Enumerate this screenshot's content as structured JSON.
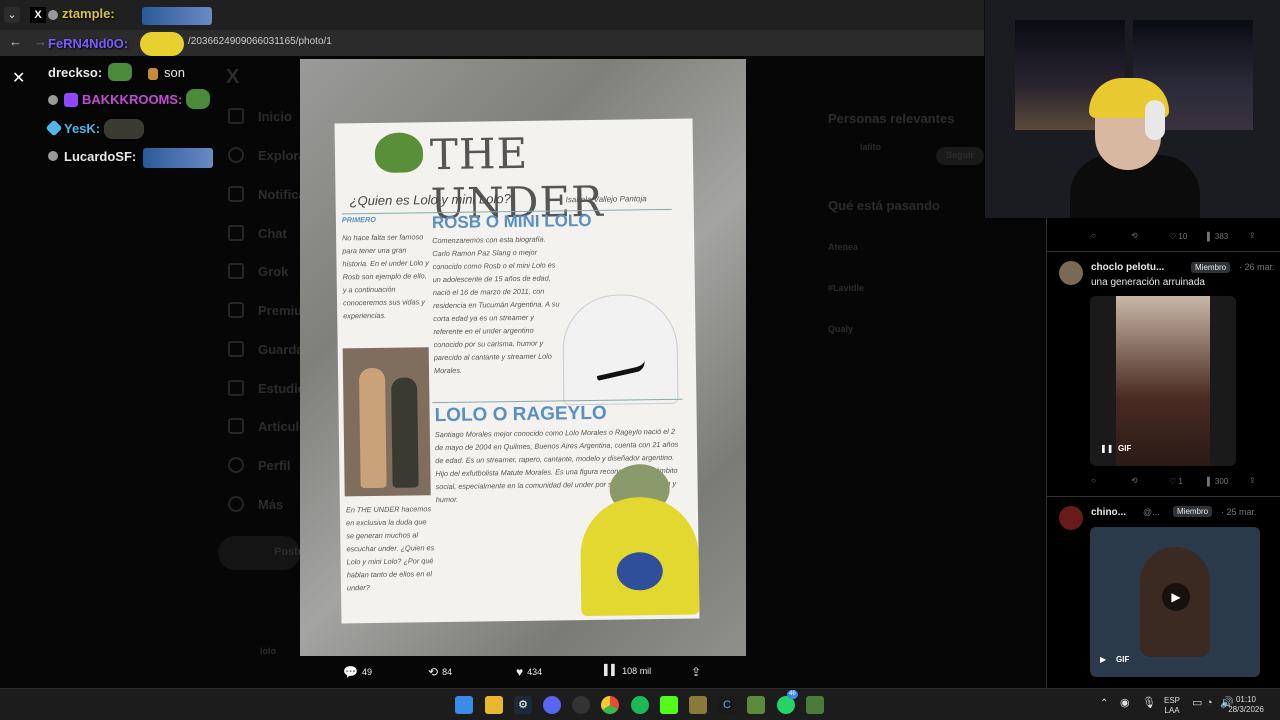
{
  "browser": {
    "url": "/2036624909066031165/photo/1"
  },
  "chat": [
    {
      "user": "ztample:",
      "color": "#d4c04a"
    },
    {
      "user": "FeRN4Nd0O:",
      "color": "#7b5cff"
    },
    {
      "user": "drecksο:",
      "color": "#e7e9ea",
      "message": "son"
    },
    {
      "user": "BAKKKROOMS:",
      "color": "#c44bd8"
    },
    {
      "user": "YesK:",
      "color": "#4fb6e8"
    },
    {
      "user": "LucardoSF:",
      "color": "#e7e9ea"
    }
  ],
  "xpage_dim": {
    "nav": [
      "Inicio",
      "Explorar",
      "Notificaciones",
      "Chat",
      "Grok",
      "Premium",
      "Guardados",
      "Estudio",
      "Artículos",
      "Perfil",
      "Más"
    ],
    "post_button": "Postear",
    "relevant_title": "Personas relevantes",
    "trending_title": "Qué está pasando",
    "trends": [
      "Atenea",
      "#Lavidle",
      "Qualy"
    ],
    "relevant_user": "lalito",
    "follow": "Seguir",
    "bottom_user": "lolo"
  },
  "photo": {
    "title": "THE UNDER",
    "subtitle": "¿Quien es Lolo y mini Lolo?",
    "author": "Isabela Vallejo Pantoja",
    "section1": "ROSB O MINI LOLO",
    "section2": "LOLO O RAGEYLO",
    "left_heading": "PRIMERO",
    "text_left": "No hace falta ser famoso para tener una gran historia. En el under Lolo y Rosb son ejemplo de ello, y a continuación conoceremos sus vidas y experiencias.",
    "text_rosb": "Comenzaremos con esta biografía. Carlo Ramon Paz Slang o mejor conocido como Rosb o el mini Lolo es un adolescente de 15 años de edad, nació el 16 de marzo de 2011, con residencia en Tucumán Argentina. A su corta edad ya es un streamer y referente en el under argentino conocido por su carisma, humor y parecido al cantante y streamer Lolo Morales.",
    "text_lolo": "Santiago Morales mejor conocido como Lolo Morales o Rageylo nació el 2 de mayo de 2004 en Quilmes, Buenos Aires Argentina, cuenta con 21 años de edad. Es un streamer, rapero, cantante, modelo y diseñador argentino. Hijo del exfutbolista Matute Morales. Es una figura reconocida en el ámbito social, especialmente en la comunidad del under por su estilo, expresión y humor.",
    "text_bottom_left": "En THE UNDER hacemos en exclusiva la duda que se generan muchos al escuchar under. ¿Quien es Lolo y mini Lolo? ¿Por qué hablan tanto de ellos en el under?"
  },
  "photo_stats": {
    "replies": "49",
    "reposts": "84",
    "likes": "434",
    "views": "108 mil"
  },
  "feed": {
    "top_actions": {
      "likes": "10",
      "views": "383"
    },
    "post1": {
      "user": "choclo pelotu...",
      "badge": "Miembro",
      "time": "· 26 mar.",
      "text": "una generación arruinada",
      "gif": "GIF",
      "likes": "1",
      "views": "300"
    },
    "post2": {
      "user": "chino...",
      "handle": "@...",
      "badge": "Miembro",
      "time": "· 25 mar.",
      "gif": "GIF"
    }
  },
  "taskbar": {
    "lang1": "ESP",
    "lang2": "LAA",
    "time": "01:10",
    "date": "28/3/2026",
    "whatsapp_count": "46"
  }
}
